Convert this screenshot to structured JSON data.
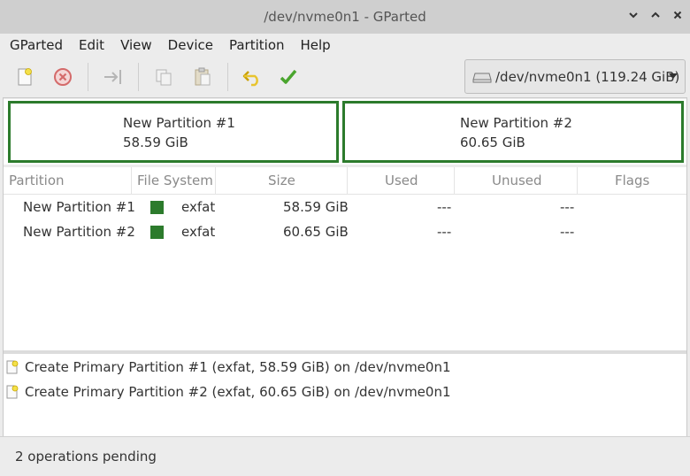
{
  "window": {
    "title": "/dev/nvme0n1 - GParted"
  },
  "menu": [
    "GParted",
    "Edit",
    "View",
    "Device",
    "Partition",
    "Help"
  ],
  "toolbar": {
    "device_label": "/dev/nvme0n1 (119.24 GiB)"
  },
  "visual": {
    "partitions": [
      {
        "name": "New Partition #1",
        "size": "58.59 GiB"
      },
      {
        "name": "New Partition #2",
        "size": "60.65 GiB"
      }
    ]
  },
  "table": {
    "columns": [
      "Partition",
      "File System",
      "Size",
      "Used",
      "Unused",
      "Flags"
    ],
    "rows": [
      {
        "partition": "New Partition #1",
        "fs": "exfat",
        "size": "58.59 GiB",
        "used": "---",
        "unused": "---",
        "flags": ""
      },
      {
        "partition": "New Partition #2",
        "fs": "exfat",
        "size": "60.65 GiB",
        "used": "---",
        "unused": "---",
        "flags": ""
      }
    ]
  },
  "operations": [
    "Create Primary Partition #1 (exfat, 58.59 GiB) on /dev/nvme0n1",
    "Create Primary Partition #2 (exfat, 60.65 GiB) on /dev/nvme0n1"
  ],
  "status": {
    "text": "2 operations pending"
  },
  "colors": {
    "partition_border": "#2c7b2c",
    "fs_exfat": "#2c7b2c"
  }
}
